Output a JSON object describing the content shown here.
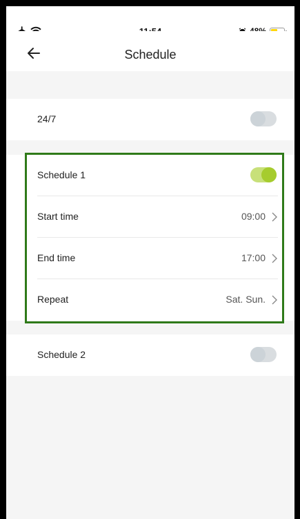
{
  "status_bar": {
    "time": "11:54",
    "battery_percent": "48%",
    "battery_level": 0.48
  },
  "header": {
    "title": "Schedule"
  },
  "rows": {
    "all_week": {
      "label": "24/7",
      "enabled": false
    },
    "schedule1": {
      "label": "Schedule 1",
      "enabled": true
    },
    "start_time": {
      "label": "Start time",
      "value": "09:00"
    },
    "end_time": {
      "label": "End time",
      "value": "17:00"
    },
    "repeat": {
      "label": "Repeat",
      "value": "Sat. Sun."
    },
    "schedule2": {
      "label": "Schedule 2",
      "enabled": false
    }
  },
  "colors": {
    "toggle_on_track": "#c8e07a",
    "toggle_on_knob": "#a6cc2e",
    "toggle_off_track": "#d9dde0",
    "highlight_border": "#2f7a19"
  },
  "icons": {
    "airplane": "airplane-icon",
    "wifi": "wifi-icon",
    "alarm": "alarm-icon",
    "battery": "battery-icon",
    "back": "back-arrow-icon",
    "chevron": "chevron-right-icon"
  }
}
